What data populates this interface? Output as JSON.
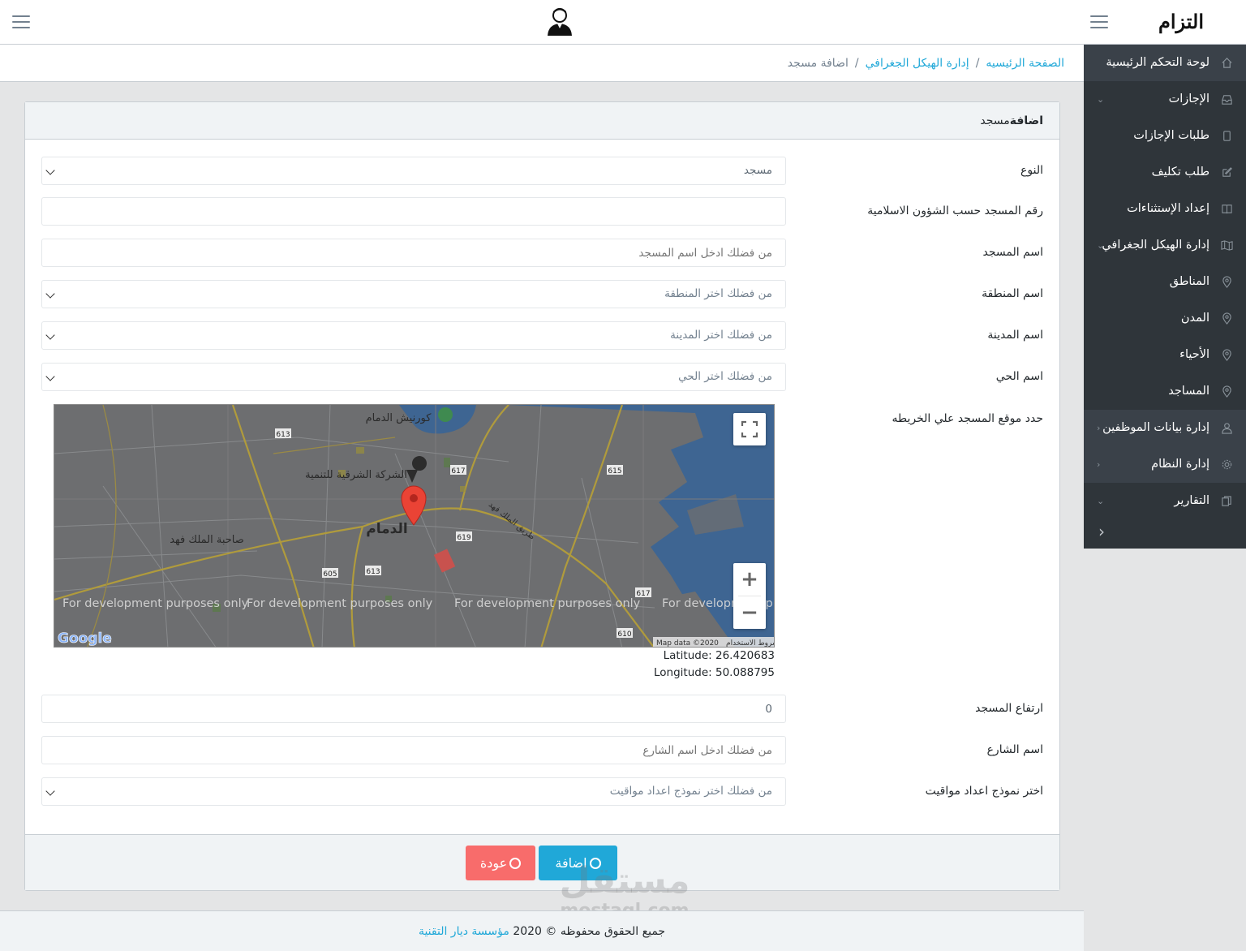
{
  "header": {
    "brand": "التزام"
  },
  "sidebar": {
    "items": [
      {
        "label": "لوحة التحكم الرئيسية",
        "icon": "home-icon"
      },
      {
        "label": "الإجازات",
        "icon": "inbox-icon"
      },
      {
        "label": "طلبات الإجازات",
        "icon": "tablet-icon"
      },
      {
        "label": "طلب تكليف",
        "icon": "edit-icon"
      },
      {
        "label": "إعداد الإستثناءات",
        "icon": "book-icon"
      },
      {
        "label": "إدارة الهيكل الجغرافي",
        "icon": "map-icon"
      },
      {
        "label": "المناطق",
        "icon": "location-pin-icon"
      },
      {
        "label": "المدن",
        "icon": "location-pin-icon"
      },
      {
        "label": "الأحياء",
        "icon": "location-pin-icon"
      },
      {
        "label": "المساجد",
        "icon": "location-pin-icon"
      },
      {
        "label": "إدارة بيانات الموظفين",
        "icon": "user-icon"
      },
      {
        "label": "إدارة النظام",
        "icon": "gear-icon"
      },
      {
        "label": "التقارير",
        "icon": "copy-icon"
      }
    ]
  },
  "breadcrumb": {
    "home": "الصفحة الرئيسيه",
    "section": "إدارة الهيكل الجغرافي",
    "current": "اضافة مسجد"
  },
  "card": {
    "title_bold": "اضافة",
    "title_rest": "مسجد"
  },
  "form": {
    "type": {
      "label": "النوع",
      "value": "مسجد"
    },
    "number": {
      "label": "رقم المسجد حسب الشؤون الاسلامية",
      "value": ""
    },
    "name": {
      "label": "اسم المسجد",
      "placeholder": "من فضلك ادخل اسم المسجد"
    },
    "region": {
      "label": "اسم المنطقة",
      "value": "من فضلك اختر المنطقة"
    },
    "city": {
      "label": "اسم المدينة",
      "value": "من فضلك اختر المدينة"
    },
    "district": {
      "label": "اسم الحي",
      "value": "من فضلك اختر الحي"
    },
    "map": {
      "label": "حدد موقع المسجد علي الخريطه"
    },
    "height": {
      "label": "ارتفاع المسجد",
      "value": "0"
    },
    "street": {
      "label": "اسم الشارع",
      "placeholder": "من فضلك ادخل اسم الشارع"
    },
    "timing": {
      "label": "اختر نموذج اعداد مواقيت",
      "value": "من فضلك اختر نموذج اعداد مواقيت"
    }
  },
  "map": {
    "latitude": "Latitude: 26.420683",
    "longitude": "Longitude: 50.088795",
    "city_label": "الدمام",
    "labels": [
      "كورنيش الدمام",
      "الشركة الشرقية للتنمية",
      "صاحبة الملك فهد",
      "طريق الملك فهد"
    ],
    "dev_text": "For development purposes only",
    "attribution": "Map data ©2020",
    "terms": "شروط الاستخدام",
    "road_shields": [
      "613",
      "617",
      "615",
      "619",
      "605",
      "613",
      "617",
      "610"
    ],
    "google": "Google",
    "zoom_in": "+",
    "zoom_out": "−"
  },
  "buttons": {
    "add": "اضافة",
    "back": "عودة"
  },
  "footer": {
    "text": "جميع الحقوق محفوظه © 2020",
    "link": "مؤسسة ديار التقنية"
  },
  "watermark": {
    "line1": "مستقل",
    "line2": "mostaql.com"
  },
  "colors": {
    "primary": "#20a8d8",
    "danger": "#f86c6b",
    "sidebar": "#2f353a",
    "pin": "#ea4335"
  }
}
